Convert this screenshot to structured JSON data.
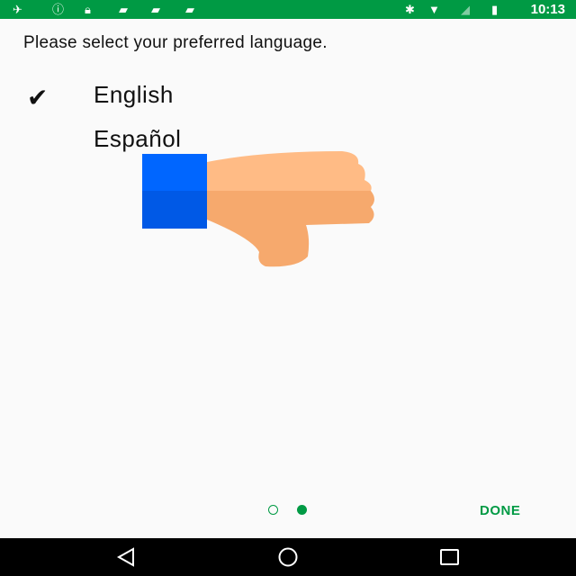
{
  "status_bar": {
    "time": "10:13",
    "icons": [
      "satellite-icon",
      "alert-circle-icon",
      "lock-icon",
      "briefcase-check-icon",
      "briefcase-play-icon",
      "android-icon",
      "bluetooth-icon",
      "wifi-icon",
      "no-signal-icon",
      "battery-charging-icon"
    ]
  },
  "prompt": "Please select your preferred language.",
  "languages": [
    {
      "label": "English",
      "selected": true
    },
    {
      "label": "Español",
      "selected": false
    }
  ],
  "overlay": {
    "icon": "thumbs-down-icon",
    "colors": {
      "cuff": "#0066ff",
      "hand": "#ffbb85"
    }
  },
  "pager": {
    "pages": 2,
    "current": 2
  },
  "done_label": "DONE",
  "accent": "#009a44",
  "nav_bar": {
    "icons": [
      "back-icon",
      "home-icon",
      "recents-icon"
    ]
  }
}
